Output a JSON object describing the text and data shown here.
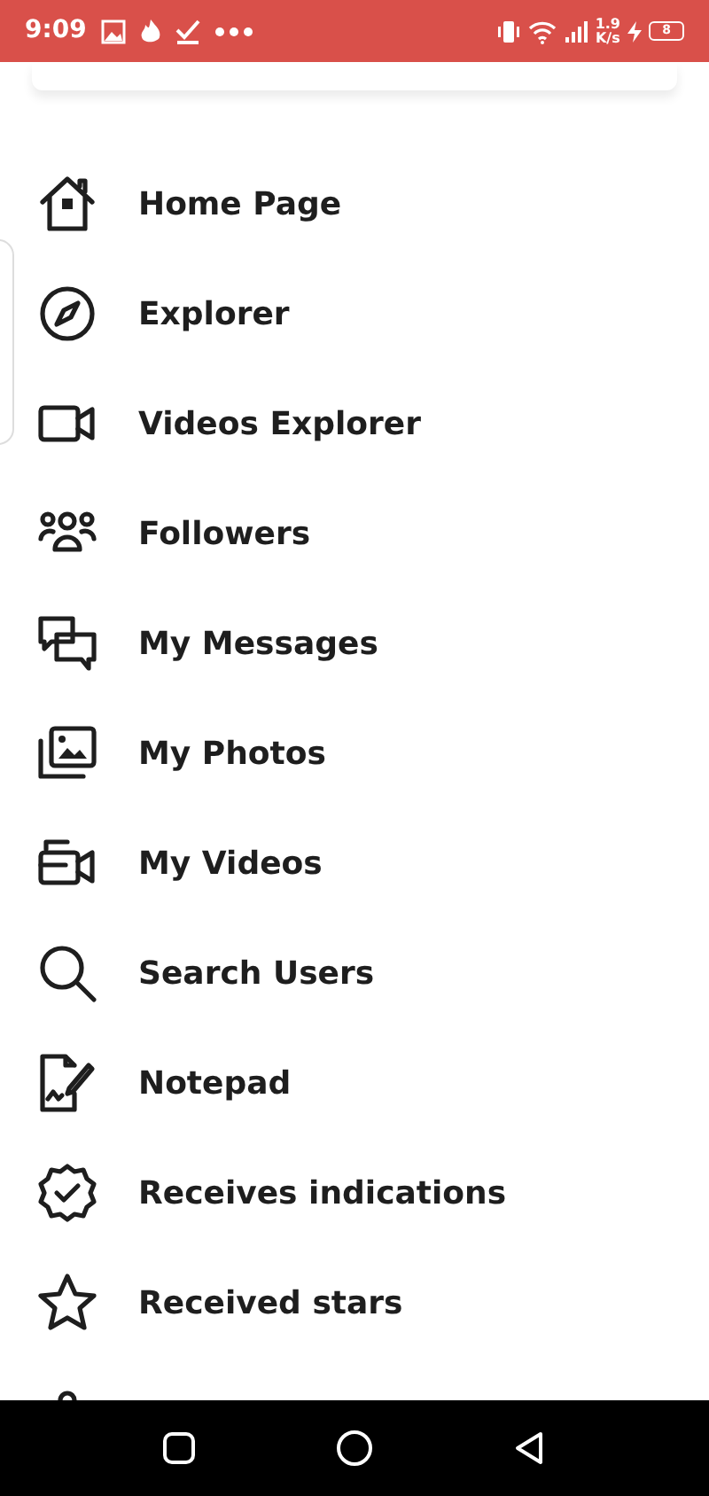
{
  "status_bar": {
    "time": "9:09",
    "speed_value": "1.9",
    "speed_unit": "K/s",
    "battery": "8"
  },
  "menu": [
    {
      "label": "Home Page"
    },
    {
      "label": "Explorer"
    },
    {
      "label": "Videos Explorer"
    },
    {
      "label": "Followers"
    },
    {
      "label": "My Messages"
    },
    {
      "label": "My Photos"
    },
    {
      "label": "My Videos"
    },
    {
      "label": "Search Users"
    },
    {
      "label": "Notepad"
    },
    {
      "label": "Receives indications"
    },
    {
      "label": "Received stars"
    }
  ]
}
